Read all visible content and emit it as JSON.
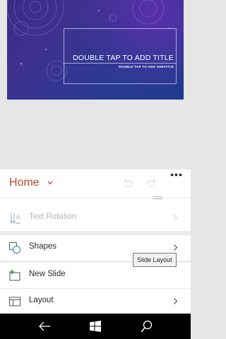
{
  "slide": {
    "title_placeholder": "DOUBLE TAP TO ADD TITLE",
    "subtitle_placeholder": "DOUBLE TAP TO ADD SUBTITLE"
  },
  "ribbon": {
    "more_label": "•••",
    "tab_name": "Home",
    "accent_color": "#b7472a",
    "commands": [
      {
        "label": "Text Rotation",
        "icon": "text-rotation-icon",
        "enabled": false
      },
      {
        "label": "Shapes",
        "icon": "shapes-icon",
        "enabled": true
      },
      {
        "label": "New Slide",
        "icon": "new-slide-icon",
        "enabled": true
      },
      {
        "label": "Layout",
        "icon": "layout-icon",
        "enabled": true
      }
    ]
  },
  "tooltip": {
    "text": "Slide Layout"
  },
  "navbar": {
    "icons": [
      "back-arrow-icon",
      "windows-start-icon",
      "search-icon"
    ]
  }
}
